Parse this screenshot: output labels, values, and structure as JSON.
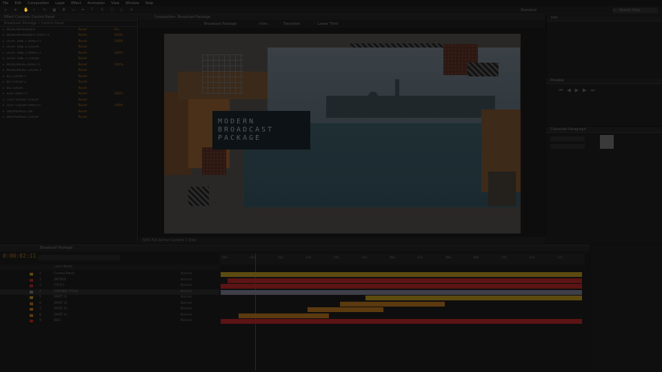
{
  "menu": [
    "File",
    "Edit",
    "Composition",
    "Layer",
    "Effect",
    "Animation",
    "View",
    "Window",
    "Help"
  ],
  "toolbar": {
    "workspace": "Standard",
    "search_placeholder": "Search Help"
  },
  "effects_panel": {
    "tab": "Effect Controls: Control Panel",
    "subtitle": "Broadcast Package • Control Panel",
    "controls": [
      {
        "name": "MODERN BORDER",
        "reset": "Reset",
        "value": "0%"
      },
      {
        "name": "MODERN BORDER OPACITY",
        "reset": "Reset",
        "value": "100%"
      },
      {
        "name": "LIGHT LINE 1 OPACITY",
        "reset": "Reset",
        "value": "100%"
      },
      {
        "name": "LIGHT LINE 1 COLOR",
        "reset": "Reset",
        "value": ""
      },
      {
        "name": "LIGHT LINE 2 OPACITY",
        "reset": "Reset",
        "value": "100%"
      },
      {
        "name": "LIGHT LINE 2 COLOR",
        "reset": "Reset",
        "value": ""
      },
      {
        "name": "MODERN BG OPACITY",
        "reset": "Reset",
        "value": "100%"
      },
      {
        "name": "MODERN BG COLOR 1",
        "reset": "Reset",
        "value": ""
      },
      {
        "name": "BG COLOR 1",
        "reset": "Reset",
        "value": ""
      },
      {
        "name": "BG COLOR 2",
        "reset": "Reset",
        "value": ""
      },
      {
        "name": "BG COLOR",
        "reset": "Reset",
        "value": ""
      },
      {
        "name": "SIZE OPACITY",
        "reset": "Reset",
        "value": "100%"
      },
      {
        "name": "TEXT SHADE COLOR",
        "reset": "Reset",
        "value": ""
      },
      {
        "name": "TEXT COLOR OPACITY",
        "reset": "Reset",
        "value": "100%"
      },
      {
        "name": "DROPSHADE ON",
        "reset": "Reset",
        "value": ""
      },
      {
        "name": "DROPSHADE COLOR",
        "reset": "Reset",
        "value": ""
      }
    ]
  },
  "comp_panel": {
    "tab": "Composition: Broadcast Package",
    "sub_tabs": [
      "Broadcast Package",
      "Intro",
      "Transition",
      "Lower Third"
    ],
    "status": "50%   Full   Active Camera   1 View",
    "title_lines": [
      "MODERN",
      "BROADCAST",
      "PACKAGE"
    ]
  },
  "right_panels": {
    "info": "Info",
    "preview": "Preview",
    "character": "Character",
    "paragraph": "Paragraph"
  },
  "timeline": {
    "tab": "Broadcast Package",
    "timecode": "0:00:02:11",
    "ruler_ticks": [
      "00s",
      "01s",
      "02s",
      "03s",
      "04s",
      "05s",
      "06s",
      "07s",
      "08s",
      "09s",
      "10s",
      "11s",
      "12s"
    ],
    "header": "Layer Name",
    "layers": [
      {
        "num": "1",
        "name": "Control Panel",
        "mode": "Normal",
        "color": "#5c4a10"
      },
      {
        "num": "2",
        "name": "[INTRO]",
        "mode": "Normal",
        "color": "#5c1414"
      },
      {
        "num": "3",
        "name": "[TEXT]",
        "mode": "Normal",
        "color": "#5c1414"
      },
      {
        "num": "4",
        "name": "[OPENER TITLE]",
        "mode": "Normal",
        "color": "#3f3f4a"
      },
      {
        "num": "5",
        "name": "[PART 4]",
        "mode": "Normal",
        "color": "#5c4a10"
      },
      {
        "num": "6",
        "name": "[PART 3]",
        "mode": "Normal",
        "color": "#5c3a10"
      },
      {
        "num": "7",
        "name": "[PART 2]",
        "mode": "Normal",
        "color": "#5c3a10"
      },
      {
        "num": "8",
        "name": "[PART 1]",
        "mode": "Normal",
        "color": "#5c3a10"
      },
      {
        "num": "9",
        "name": "[BG]",
        "mode": "Normal",
        "color": "#5c1414"
      }
    ]
  }
}
